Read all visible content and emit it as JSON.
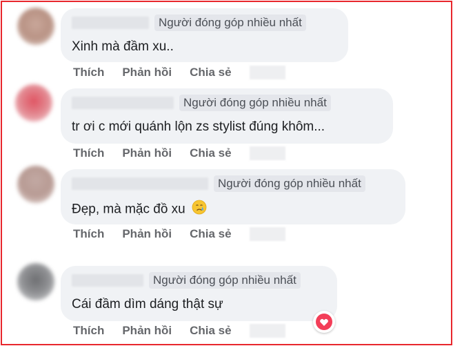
{
  "badge_label": "Người đóng góp nhiều nhất",
  "actions": {
    "like": "Thích",
    "reply": "Phản hồi",
    "share": "Chia sẻ"
  },
  "comments": [
    {
      "text": "Xinh mà đầm xu.."
    },
    {
      "text": "tr ơi c mới quánh lộn zs stylist đúng khôm..."
    },
    {
      "text": "Đẹp, mà mặc đồ xu",
      "emoji": "crying-face-icon"
    },
    {
      "text": "Cái đầm dìm dáng thật sự",
      "reaction": "love-reaction-icon"
    }
  ],
  "colors": {
    "border": "#e8262c",
    "bubble": "#f0f2f5",
    "action_text": "#65676b",
    "love": "#f33e58"
  }
}
